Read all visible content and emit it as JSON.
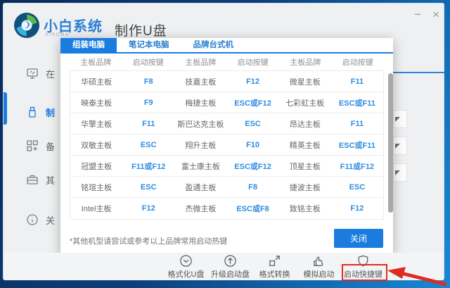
{
  "window": {
    "app_name": "小白系统",
    "app_name_sub": "XIAOBA",
    "page_heading": "制作U盘",
    "controls": {
      "minimize": "−",
      "close": "×"
    }
  },
  "sidebar": {
    "items": [
      {
        "label": "在",
        "icon": "monitor-icon",
        "active": false
      },
      {
        "label": "制",
        "icon": "usb-drive-icon",
        "active": true
      },
      {
        "label": "备",
        "icon": "backup-grid-icon",
        "active": false
      },
      {
        "label": "其",
        "icon": "briefcase-icon",
        "active": false
      },
      {
        "label": "关",
        "icon": "info-icon",
        "active": false
      }
    ]
  },
  "dialog": {
    "tabs": [
      {
        "label": "组装电脑",
        "active": true
      },
      {
        "label": "笔记本电脑",
        "active": false
      },
      {
        "label": "品牌台式机",
        "active": false
      }
    ],
    "column_headers": [
      "主板品牌",
      "启动按键",
      "主板品牌",
      "启动按键",
      "主板品牌",
      "启动按键"
    ],
    "rows": [
      [
        "华硕主板",
        "F8",
        "技嘉主板",
        "F12",
        "微星主板",
        "F11"
      ],
      [
        "映泰主板",
        "F9",
        "梅捷主板",
        "ESC或F12",
        "七彩虹主板",
        "ESC或F11"
      ],
      [
        "华擎主板",
        "F11",
        "斯巴达克主板",
        "ESC",
        "昂达主板",
        "F11"
      ],
      [
        "双敏主板",
        "ESC",
        "翔升主板",
        "F10",
        "精英主板",
        "ESC或F11"
      ],
      [
        "冠盟主板",
        "F11或F12",
        "富士康主板",
        "ESC或F12",
        "顶星主板",
        "F11或F12"
      ],
      [
        "铭瑄主板",
        "ESC",
        "盈通主板",
        "F8",
        "捷波主板",
        "ESC"
      ],
      [
        "Intel主板",
        "F12",
        "杰微主板",
        "ESC或F8",
        "致铭主板",
        "F12"
      ]
    ],
    "note": "*其他机型请尝试或参考以上品牌常用启动热键",
    "close_label": "关闭"
  },
  "footer": {
    "items": [
      {
        "label": "格式化U盘",
        "icon": "check-circle-icon"
      },
      {
        "label": "升级启动盘",
        "icon": "arrow-up-circle-icon"
      },
      {
        "label": "格式转换",
        "icon": "convert-icon"
      },
      {
        "label": "模拟启动",
        "icon": "thumb-up-icon"
      },
      {
        "label": "启动快捷键",
        "icon": "shield-icon",
        "highlighted": true
      }
    ]
  },
  "colors": {
    "accent_blue": "#1b7ce0",
    "key_blue": "#2f8ce2",
    "annotation_red": "#e02b20"
  }
}
